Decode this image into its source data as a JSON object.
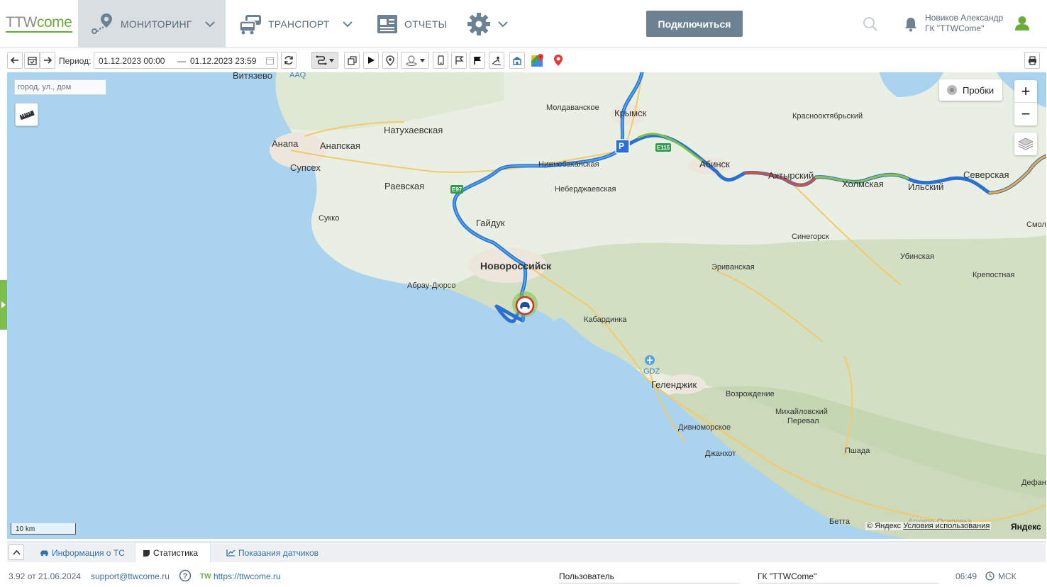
{
  "app": {
    "logo_part1": "TTW",
    "logo_part2": "come",
    "accent_color": "#6aab3c"
  },
  "nav": {
    "monitoring": "МОНИТОРИНГ",
    "transport": "ТРАНСПОРТ",
    "reports": "ОТЧЕТЫ",
    "connect_button": "Подключиться"
  },
  "user": {
    "name": "Новиков Александр",
    "company": "ГК \"TTWCome\""
  },
  "toolbar": {
    "period_label": "Период:",
    "date_from": "01.12.2023 00:00",
    "date_separator": "—",
    "date_to": "01.12.2023 23:59"
  },
  "map": {
    "search_placeholder": "город, ул., дом",
    "traffic_button": "Пробки",
    "zoom_in": "+",
    "zoom_out": "−",
    "scale_label": "10 km",
    "copyright_prefix": "© Яндекс",
    "terms_link": "Условия использования",
    "provider_logo": "Яндекс",
    "parking_marker": "P",
    "airport_code": "GDZ",
    "aaq_code": "AAQ",
    "road_e97": "E97",
    "road_e115": "E115",
    "places": {
      "vityazevo": "Витязево",
      "moldavanskoe": "Молдаванское",
      "krymsk": "Крымск",
      "krasnooktyabrsky": "Краснооктябрьский",
      "natukhaevskaya": "Натухаевская",
      "anapa": "Анапа",
      "anapskaya": "Анапская",
      "abinsk": "Абинск",
      "akhtyrsky": "Ахтырский",
      "severskaya": "Северская",
      "supseh": "Супсех",
      "nizhnebakanskaya": "Нижнебаканская",
      "raevskaya": "Раевская",
      "neberdzhaevskaya": "Неберджаевская",
      "kholmskaya": "Холмская",
      "ilsky": "Ильский",
      "sukko": "Сукко",
      "gaiduk": "Гайдук",
      "smolenskaya": "Смол",
      "sinegorsk": "Синегорск",
      "ubinskaya": "Убинская",
      "novorossiysk": "Новороссийск",
      "erivanskaya": "Эриванская",
      "krepostnaya": "Крепостная",
      "abrau": "Абрау-Дюрсо",
      "kabardinka": "Кабардинка",
      "gelendzhik": "Геленджик",
      "vozrozhdenie": "Возрождение",
      "mikhailovsky": "Михайловский",
      "pereval": "Перевал",
      "divnomorskoe": "Дивноморское",
      "dzhankhot": "Джанхот",
      "pshada": "Пшада",
      "defanovka": "Дефан",
      "betta": "Бетта",
      "arkhipo": "Архипо-Осиповка"
    }
  },
  "tabs": {
    "vehicle_info": "Информация о ТС",
    "statistics": "Статистика",
    "sensors": "Показания датчиков"
  },
  "status": {
    "version": "3.92 от 21.06.2024",
    "support_email": "support@ttwcome.ru",
    "tw_prefix": "TW",
    "site": "https://ttwcome.ru",
    "user_field": "Пользователь",
    "company_field": "ГК \"TTWCome\"",
    "time": "06:49",
    "timezone": "МСК"
  }
}
